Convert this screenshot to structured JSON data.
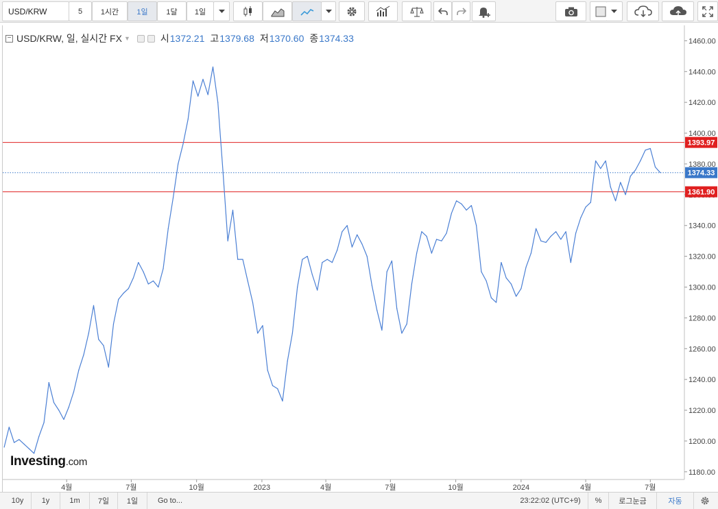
{
  "toolbar": {
    "symbol": "USD/KRW",
    "intervals": [
      "5",
      "1시간",
      "1일",
      "1달",
      "1일"
    ],
    "active_interval_index": 2
  },
  "legend": {
    "title": "USD/KRW, 일, 실시간 FX",
    "open_label": "시",
    "open": "1372.21",
    "high_label": "고",
    "high": "1379.68",
    "low_label": "저",
    "low": "1370.60",
    "close_label": "종",
    "close": "1374.33"
  },
  "watermark": {
    "brand": "Investing",
    "suffix": ".com"
  },
  "bottombar": {
    "ranges": [
      "10y",
      "1y",
      "1m",
      "7일",
      "1일"
    ],
    "goto": "Go to...",
    "time": "23:22:02 (UTC+9)",
    "percent": "%",
    "log": "로그눈금",
    "auto": "자동"
  },
  "colors": {
    "line": "#4a7fd4",
    "hline": "#e02020",
    "price_tag": "#3a78c9",
    "accent": "#3a78c9"
  },
  "chart_data": {
    "type": "line",
    "title": "USD/KRW, 일, 실시간 FX",
    "xlabel": "",
    "ylabel": "",
    "ylim": [
      1180,
      1460
    ],
    "y_ticks": [
      1180,
      1200,
      1220,
      1240,
      1260,
      1280,
      1300,
      1320,
      1340,
      1360,
      1380,
      1400,
      1420,
      1440,
      1460
    ],
    "x_ticks": [
      {
        "label": "4월",
        "date": "2022-04-01"
      },
      {
        "label": "7월",
        "date": "2022-07-01"
      },
      {
        "label": "10월",
        "date": "2022-10-01"
      },
      {
        "label": "2023",
        "date": "2023-01-01"
      },
      {
        "label": "4월",
        "date": "2023-04-01"
      },
      {
        "label": "7월",
        "date": "2023-07-01"
      },
      {
        "label": "10월",
        "date": "2023-10-01"
      },
      {
        "label": "2024",
        "date": "2024-01-01"
      },
      {
        "label": "4월",
        "date": "2024-04-01"
      },
      {
        "label": "7월",
        "date": "2024-07-01"
      }
    ],
    "horizontal_lines": [
      {
        "value": 1393.97,
        "label": "1393.97",
        "style": "solid"
      },
      {
        "value": 1361.9,
        "label": "1361.90",
        "style": "solid"
      }
    ],
    "last_price": {
      "value": 1374.33,
      "label": "1374.33"
    },
    "grid": false,
    "series": [
      {
        "values": [
          [
            "2022-01-03",
            1196
          ],
          [
            "2022-01-10",
            1209
          ],
          [
            "2022-01-17",
            1199
          ],
          [
            "2022-01-24",
            1201
          ],
          [
            "2022-01-31",
            1198
          ],
          [
            "2022-02-07",
            1195
          ],
          [
            "2022-02-14",
            1192
          ],
          [
            "2022-02-21",
            1203
          ],
          [
            "2022-02-28",
            1212
          ],
          [
            "2022-03-07",
            1238
          ],
          [
            "2022-03-14",
            1225
          ],
          [
            "2022-03-21",
            1220
          ],
          [
            "2022-03-28",
            1214
          ],
          [
            "2022-04-04",
            1222
          ],
          [
            "2022-04-11",
            1232
          ],
          [
            "2022-04-18",
            1246
          ],
          [
            "2022-04-25",
            1256
          ],
          [
            "2022-05-02",
            1270
          ],
          [
            "2022-05-09",
            1288
          ],
          [
            "2022-05-16",
            1266
          ],
          [
            "2022-05-23",
            1262
          ],
          [
            "2022-05-30",
            1248
          ],
          [
            "2022-06-06",
            1276
          ],
          [
            "2022-06-13",
            1292
          ],
          [
            "2022-06-20",
            1296
          ],
          [
            "2022-06-27",
            1299
          ],
          [
            "2022-07-04",
            1306
          ],
          [
            "2022-07-11",
            1316
          ],
          [
            "2022-07-18",
            1310
          ],
          [
            "2022-07-25",
            1302
          ],
          [
            "2022-08-01",
            1304
          ],
          [
            "2022-08-08",
            1300
          ],
          [
            "2022-08-15",
            1312
          ],
          [
            "2022-08-22",
            1338
          ],
          [
            "2022-08-29",
            1358
          ],
          [
            "2022-09-05",
            1380
          ],
          [
            "2022-09-12",
            1393
          ],
          [
            "2022-09-19",
            1409
          ],
          [
            "2022-09-26",
            1434
          ],
          [
            "2022-10-03",
            1424
          ],
          [
            "2022-10-10",
            1435
          ],
          [
            "2022-10-17",
            1425
          ],
          [
            "2022-10-24",
            1443
          ],
          [
            "2022-10-31",
            1420
          ],
          [
            "2022-11-07",
            1376
          ],
          [
            "2022-11-14",
            1330
          ],
          [
            "2022-11-21",
            1350
          ],
          [
            "2022-11-28",
            1318
          ],
          [
            "2022-12-05",
            1318
          ],
          [
            "2022-12-12",
            1304
          ],
          [
            "2022-12-19",
            1290
          ],
          [
            "2022-12-26",
            1270
          ],
          [
            "2023-01-02",
            1275
          ],
          [
            "2023-01-09",
            1246
          ],
          [
            "2023-01-16",
            1236
          ],
          [
            "2023-01-23",
            1234
          ],
          [
            "2023-01-30",
            1226
          ],
          [
            "2023-02-06",
            1252
          ],
          [
            "2023-02-13",
            1270
          ],
          [
            "2023-02-20",
            1300
          ],
          [
            "2023-02-27",
            1318
          ],
          [
            "2023-03-06",
            1320
          ],
          [
            "2023-03-13",
            1308
          ],
          [
            "2023-03-20",
            1298
          ],
          [
            "2023-03-27",
            1316
          ],
          [
            "2023-04-03",
            1318
          ],
          [
            "2023-04-10",
            1316
          ],
          [
            "2023-04-17",
            1324
          ],
          [
            "2023-04-24",
            1336
          ],
          [
            "2023-05-01",
            1340
          ],
          [
            "2023-05-08",
            1326
          ],
          [
            "2023-05-15",
            1334
          ],
          [
            "2023-05-22",
            1328
          ],
          [
            "2023-05-29",
            1320
          ],
          [
            "2023-06-05",
            1301
          ],
          [
            "2023-06-12",
            1285
          ],
          [
            "2023-06-19",
            1272
          ],
          [
            "2023-06-26",
            1310
          ],
          [
            "2023-07-03",
            1317
          ],
          [
            "2023-07-10",
            1286
          ],
          [
            "2023-07-17",
            1270
          ],
          [
            "2023-07-24",
            1276
          ],
          [
            "2023-07-31",
            1302
          ],
          [
            "2023-08-07",
            1322
          ],
          [
            "2023-08-14",
            1336
          ],
          [
            "2023-08-21",
            1333
          ],
          [
            "2023-08-28",
            1322
          ],
          [
            "2023-09-04",
            1331
          ],
          [
            "2023-09-11",
            1330
          ],
          [
            "2023-09-18",
            1335
          ],
          [
            "2023-09-25",
            1348
          ],
          [
            "2023-10-02",
            1356
          ],
          [
            "2023-10-09",
            1354
          ],
          [
            "2023-10-16",
            1350
          ],
          [
            "2023-10-23",
            1353
          ],
          [
            "2023-10-30",
            1340
          ],
          [
            "2023-11-06",
            1310
          ],
          [
            "2023-11-13",
            1304
          ],
          [
            "2023-11-20",
            1293
          ],
          [
            "2023-11-27",
            1290
          ],
          [
            "2023-12-04",
            1316
          ],
          [
            "2023-12-11",
            1306
          ],
          [
            "2023-12-18",
            1302
          ],
          [
            "2023-12-25",
            1294
          ],
          [
            "2024-01-01",
            1299
          ],
          [
            "2024-01-08",
            1313
          ],
          [
            "2024-01-15",
            1322
          ],
          [
            "2024-01-22",
            1338
          ],
          [
            "2024-01-29",
            1330
          ],
          [
            "2024-02-05",
            1329
          ],
          [
            "2024-02-12",
            1333
          ],
          [
            "2024-02-19",
            1336
          ],
          [
            "2024-02-26",
            1331
          ],
          [
            "2024-03-04",
            1336
          ],
          [
            "2024-03-11",
            1316
          ],
          [
            "2024-03-18",
            1335
          ],
          [
            "2024-03-25",
            1345
          ],
          [
            "2024-04-01",
            1352
          ],
          [
            "2024-04-08",
            1355
          ],
          [
            "2024-04-15",
            1382
          ],
          [
            "2024-04-22",
            1377
          ],
          [
            "2024-04-29",
            1382
          ],
          [
            "2024-05-06",
            1365
          ],
          [
            "2024-05-13",
            1356
          ],
          [
            "2024-05-20",
            1368
          ],
          [
            "2024-05-27",
            1360
          ],
          [
            "2024-06-03",
            1372
          ],
          [
            "2024-06-10",
            1376
          ],
          [
            "2024-06-17",
            1382
          ],
          [
            "2024-06-24",
            1389
          ],
          [
            "2024-07-01",
            1390
          ],
          [
            "2024-07-08",
            1378
          ],
          [
            "2024-07-15",
            1374.33
          ]
        ]
      }
    ]
  }
}
